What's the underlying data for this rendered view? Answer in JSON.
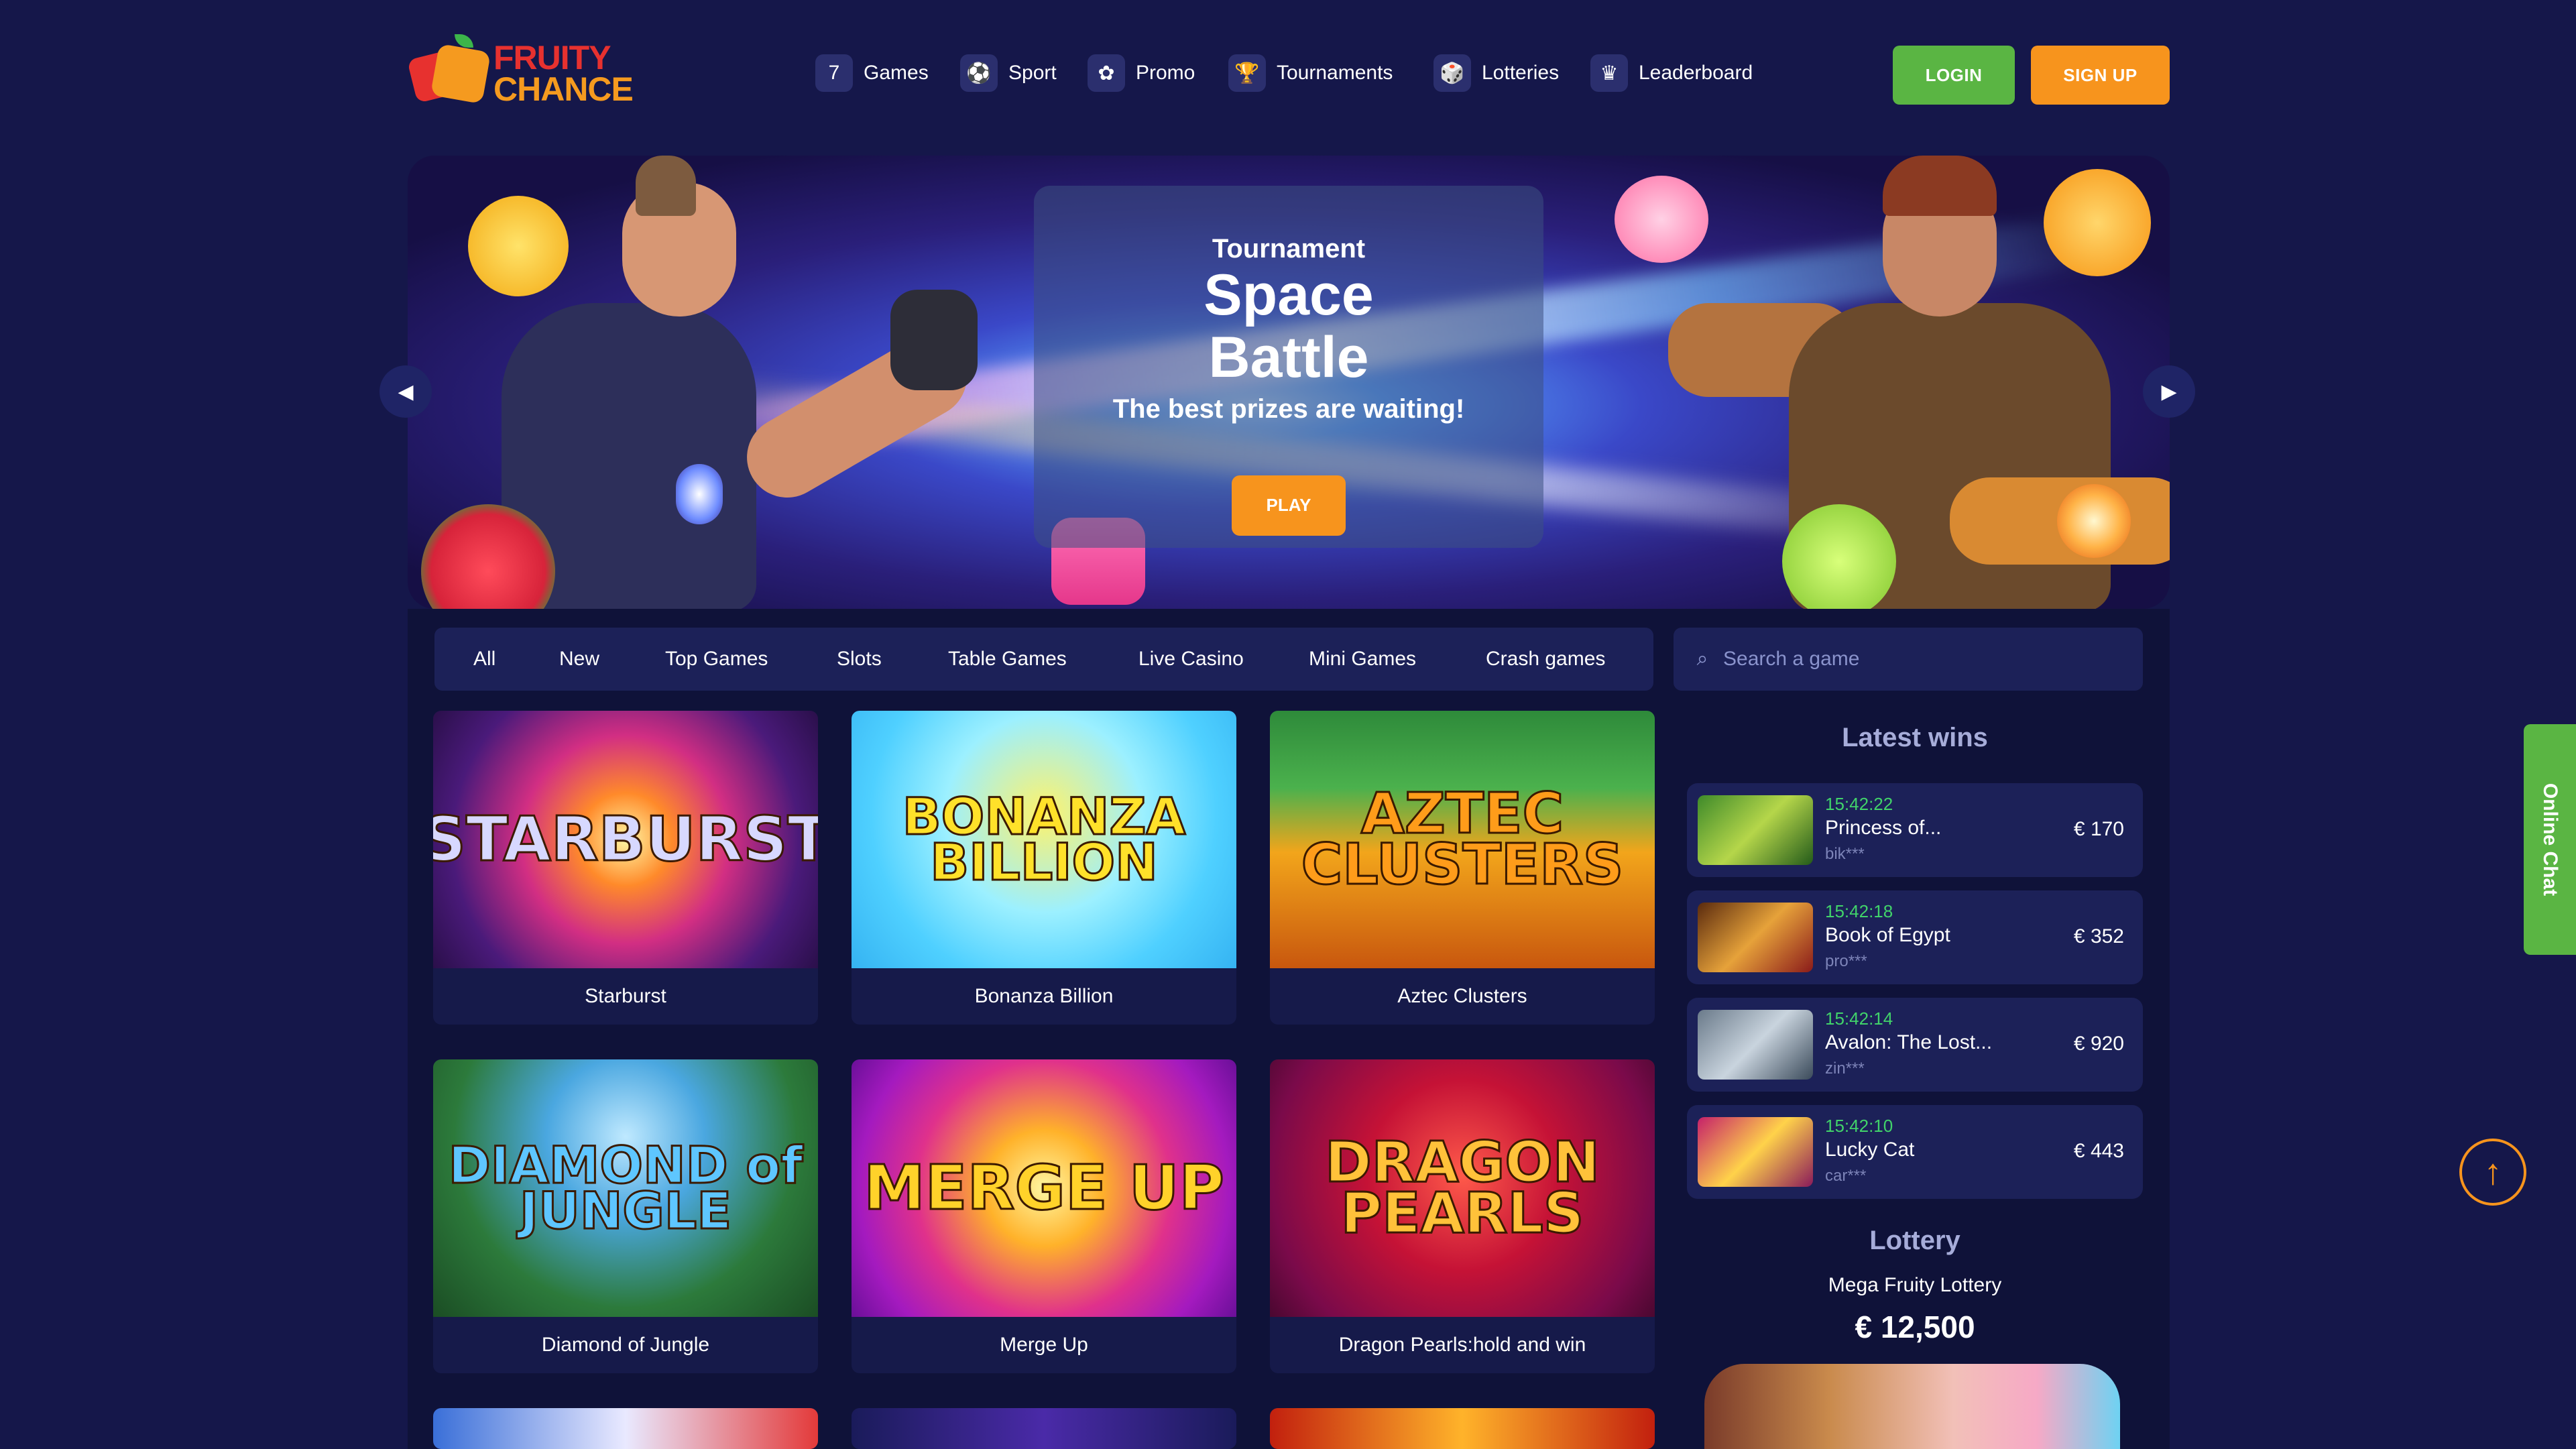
{
  "brand": {
    "line1": "FRUITY",
    "line2": "CHANCE"
  },
  "nav": {
    "items": [
      {
        "label": "Games",
        "icon": "7"
      },
      {
        "label": "Sport",
        "icon": "⚽"
      },
      {
        "label": "Promo",
        "icon": "✿"
      },
      {
        "label": "Tournaments",
        "icon": "🏆"
      },
      {
        "label": "Lotteries",
        "icon": "🎲"
      },
      {
        "label": "Leaderboard",
        "icon": "♛"
      }
    ]
  },
  "auth": {
    "login": "LOGIN",
    "signup": "SIGN UP"
  },
  "banner": {
    "subtitle": "Tournament",
    "title": "Space Battle",
    "tagline": "The best prizes are waiting!",
    "cta": "PLAY"
  },
  "categories": [
    "All",
    "New",
    "Top Games",
    "Slots",
    "Table Games",
    "Live Casino",
    "Mini Games",
    "Crash games"
  ],
  "search": {
    "placeholder": "Search a game"
  },
  "games": [
    {
      "name": "Starburst",
      "art_text": "STARBURST"
    },
    {
      "name": "Bonanza Billion",
      "art_text": "BONANZA BILLION"
    },
    {
      "name": "Aztec Clusters",
      "art_text": "AZTEC CLUSTERS"
    },
    {
      "name": "Diamond of Jungle",
      "art_text": "DIAMOND of JUNGLE"
    },
    {
      "name": "Merge Up",
      "art_text": "MERGE UP"
    },
    {
      "name": "Dragon Pearls:hold and win",
      "art_text": "DRAGON PEARLS"
    }
  ],
  "latest_wins": {
    "title": "Latest wins",
    "items": [
      {
        "time": "15:42:22",
        "game": "Princess of...",
        "user": "bik***",
        "amount": "€ 170"
      },
      {
        "time": "15:42:18",
        "game": "Book of Egypt",
        "user": "pro***",
        "amount": "€ 352"
      },
      {
        "time": "15:42:14",
        "game": "Avalon: The Lost...",
        "user": "zin***",
        "amount": "€ 920"
      },
      {
        "time": "15:42:10",
        "game": "Lucky Cat",
        "user": "car***",
        "amount": "€ 443"
      }
    ]
  },
  "lottery": {
    "title": "Lottery",
    "name": "Mega Fruity Lottery",
    "prize": "€ 12,500"
  },
  "online_chat": "Online Chat",
  "colors": {
    "login": "#5ab543",
    "signup": "#f7941d",
    "background": "#15174a",
    "panel": "#1c2158",
    "win_time": "#41d36a"
  }
}
